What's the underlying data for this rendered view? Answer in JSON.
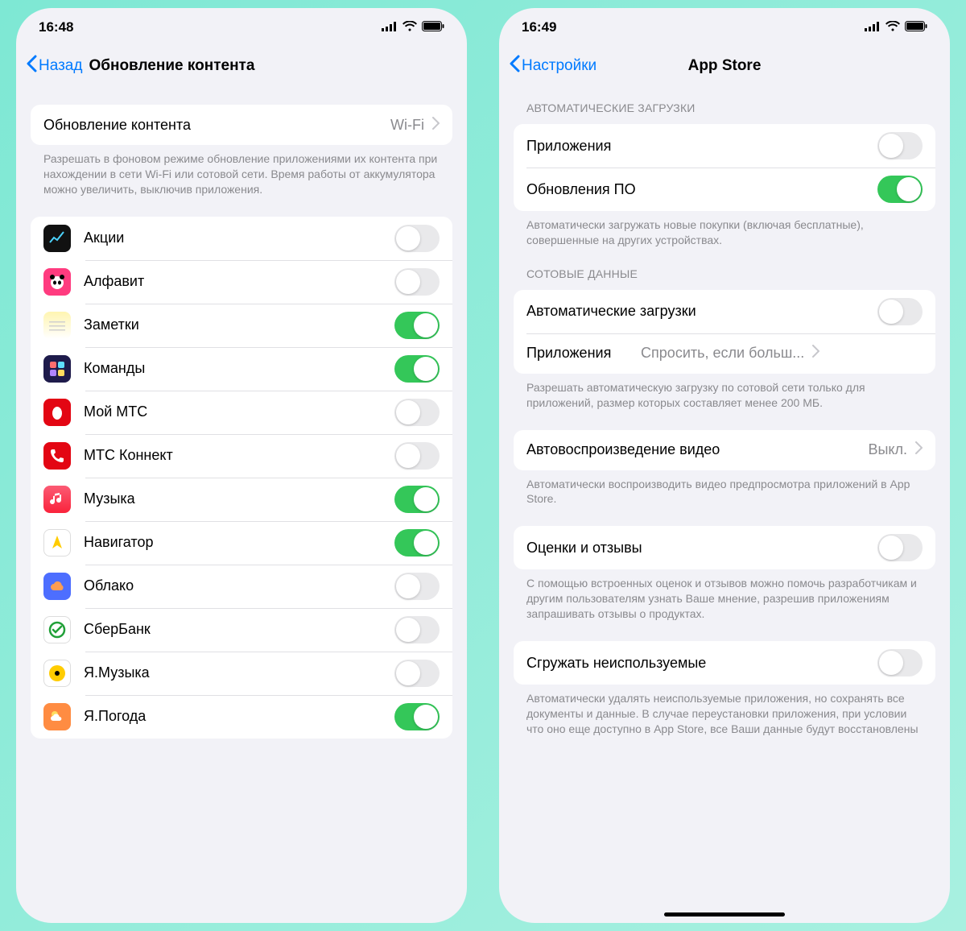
{
  "left": {
    "status": {
      "time": "16:48"
    },
    "nav": {
      "back": "Назад",
      "title": "Обновление контента"
    },
    "mode_row": {
      "label": "Обновление контента",
      "value": "Wi-Fi"
    },
    "mode_footer": "Разрешать в фоновом режиме обновление приложениями их контента при нахождении в сети Wi-Fi или сотовой сети. Время работы от аккумулятора можно увеличить, выключив приложения.",
    "apps": [
      {
        "name": "Акции",
        "on": false,
        "icon_bg": "#111",
        "icon_glyph": "stocks"
      },
      {
        "name": "Алфавит",
        "on": false,
        "icon_bg": "#ff3b7f",
        "icon_glyph": "panda"
      },
      {
        "name": "Заметки",
        "on": true,
        "icon_bg": "linear-gradient(#fff5b1,#ffffff)",
        "icon_glyph": "notes"
      },
      {
        "name": "Команды",
        "on": true,
        "icon_bg": "#1e1b4b",
        "icon_glyph": "shortcuts"
      },
      {
        "name": "Мой МТС",
        "on": false,
        "icon_bg": "#e30613",
        "icon_glyph": "egg"
      },
      {
        "name": "МТС Коннект",
        "on": false,
        "icon_bg": "#e30613",
        "icon_glyph": "phone"
      },
      {
        "name": "Музыка",
        "on": true,
        "icon_bg": "linear-gradient(#fb5b74,#fa233b)",
        "icon_glyph": "music"
      },
      {
        "name": "Навигатор",
        "on": true,
        "icon_bg": "#ffffff",
        "icon_glyph": "ynav"
      },
      {
        "name": "Облако",
        "on": false,
        "icon_bg": "#4d6eff",
        "icon_glyph": "cloud"
      },
      {
        "name": "СберБанк",
        "on": false,
        "icon_bg": "#ffffff",
        "icon_glyph": "sber"
      },
      {
        "name": "Я.Музыка",
        "on": false,
        "icon_bg": "#ffffff",
        "icon_glyph": "ymusic"
      },
      {
        "name": "Я.Погода",
        "on": true,
        "icon_bg": "#ff8c42",
        "icon_glyph": "weather"
      }
    ]
  },
  "right": {
    "status": {
      "time": "16:49"
    },
    "nav": {
      "back": "Настройки",
      "title": "App Store"
    },
    "sections": {
      "auto_dl_header": "АВТОМАТИЧЕСКИЕ ЗАГРУЗКИ",
      "auto_dl_rows": [
        {
          "label": "Приложения",
          "on": false
        },
        {
          "label": "Обновления ПО",
          "on": true
        }
      ],
      "auto_dl_footer": "Автоматически загружать новые покупки (включая бесплатные), совершенные на других устройствах.",
      "cellular_header": "СОТОВЫЕ ДАННЫЕ",
      "cellular_rows": {
        "auto": {
          "label": "Автоматические загрузки",
          "on": false
        },
        "apps": {
          "label": "Приложения",
          "value": "Спросить, если больш..."
        }
      },
      "cellular_footer": "Разрешать автоматическую загрузку по сотовой сети только для приложений, размер которых составляет менее 200 МБ.",
      "video_row": {
        "label": "Автовоспроизведение видео",
        "value": "Выкл."
      },
      "video_footer": "Автоматически воспроизводить видео предпросмотра приложений в App Store.",
      "reviews_row": {
        "label": "Оценки и отзывы",
        "on": false
      },
      "reviews_footer": "С помощью встроенных оценок и отзывов можно помочь разработчикам и другим пользователям узнать Ваше мнение, разрешив приложениям запрашивать отзывы о продуктах.",
      "offload_row": {
        "label": "Сгружать неиспользуемые",
        "on": false
      },
      "offload_footer": "Автоматически удалять неиспользуемые приложения, но сохранять все документы и данные. В случае переустановки приложения, при условии что оно еще доступно в App Store, все Ваши данные будут восстановлены"
    }
  }
}
